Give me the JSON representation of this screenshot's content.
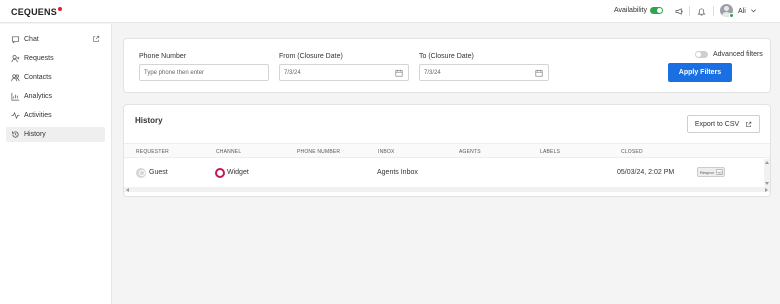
{
  "header": {
    "logo_text": "CEQUENS",
    "availability_label": "Availability",
    "availability_on": true,
    "user_name": "Ali",
    "icons": [
      "megaphone-icon",
      "bell-icon",
      "chevron-down-icon"
    ]
  },
  "sidebar": {
    "items": [
      {
        "label": "Chat",
        "icon": "chat-icon"
      },
      {
        "label": "Requests",
        "icon": "user-plus-icon"
      },
      {
        "label": "Contacts",
        "icon": "users-icon"
      },
      {
        "label": "Analytics",
        "icon": "bar-chart-icon"
      },
      {
        "label": "Activities",
        "icon": "activity-icon"
      },
      {
        "label": "History",
        "icon": "history-icon",
        "active": true
      }
    ]
  },
  "filters": {
    "phone_label": "Phone Number",
    "phone_placeholder": "Type phone then enter",
    "from_label": "From (Closure Date)",
    "from_value": "7/3/24",
    "to_label": "To (Closure Date)",
    "to_value": "7/3/24",
    "advanced_label": "Advanced filters",
    "advanced_on": false,
    "apply_label": "Apply Filters"
  },
  "history": {
    "title": "History",
    "export_label": "Export to CSV",
    "columns": [
      "REQUESTER",
      "CHANNEL",
      "PHONE NUMBER",
      "INBOX",
      "AGENTS",
      "LABELS",
      "CLOSED"
    ],
    "rows": [
      {
        "requester": "Guest",
        "channel": "Widget",
        "phone_number": "",
        "inbox": "Agents Inbox",
        "agents": "",
        "labels": "",
        "closed": "05/03/24, 2:02 PM",
        "tag": "Respon",
        "tag_count": "+0"
      }
    ]
  },
  "colors": {
    "accent": "#1a6fe3",
    "logo_dot": "#e2202c",
    "online": "#2ea44f",
    "widget": "#c2185b"
  }
}
